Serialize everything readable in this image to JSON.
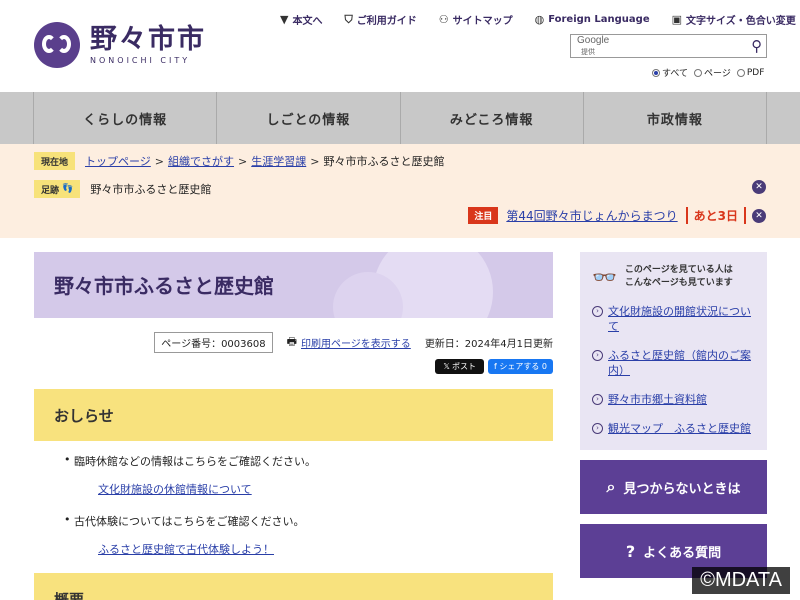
{
  "site": {
    "name": "野々市市",
    "name_en": "NONOICHI CITY"
  },
  "util_nav": [
    {
      "icon": "down-arrow-icon",
      "glyph": "▼",
      "label": "本文へ"
    },
    {
      "icon": "guide-icon",
      "glyph": "⛉",
      "label": "ご利用ガイド"
    },
    {
      "icon": "sitemap-icon",
      "glyph": "⚇",
      "label": "サイトマップ"
    },
    {
      "icon": "globe-icon",
      "glyph": "◍",
      "label": "Foreign Language"
    },
    {
      "icon": "font-size-icon",
      "glyph": "▣",
      "label": "文字サイズ・色合い変更"
    }
  ],
  "search": {
    "brand": "Google",
    "brand_sub": "提供",
    "value": "",
    "options": [
      "すべて",
      "ページ",
      "PDF"
    ],
    "selected": "すべて"
  },
  "gnav": [
    "くらしの情報",
    "しごとの情報",
    "みどころ情報",
    "市政情報"
  ],
  "breadcrumb": {
    "label": "現在地",
    "items": [
      "トップページ",
      "組織でさがす",
      "生涯学習課"
    ],
    "current": "野々市市ふるさと歴史館"
  },
  "footprint": {
    "label": "足跡",
    "text": "野々市市ふるさと歴史館"
  },
  "notice": {
    "label": "注目",
    "text": "第44回野々市じょんからまつり",
    "days": "あと3日"
  },
  "page": {
    "title": "野々市市ふるさと歴史館",
    "page_no": "ページ番号：0003608",
    "print": "印刷用ページを表示する",
    "updated": "更新日：2024年4月1日更新",
    "x_post": "𝕏 ポスト",
    "fb_share": "f シェアする 0"
  },
  "news": {
    "heading": "おしらせ",
    "items": [
      {
        "text": "臨時休館などの情報はこちらをご確認ください。",
        "link": "文化財施設の休館情報について"
      },
      {
        "text": "古代体験についてはこちらをご確認ください。",
        "link": "ふるさと歴史館で古代体験しよう！"
      }
    ]
  },
  "overview": {
    "heading": "概要"
  },
  "sidebar": {
    "related_heading_1": "このページを見ている人は",
    "related_heading_2": "こんなページも見ています",
    "related": [
      "文化財施設の開館状況について",
      "ふるさと歴史館（館内のご案内）",
      "野々市市郷土資料館",
      "観光マップ　ふるさと歴史館"
    ],
    "not_found": "見つからないときは",
    "faq": "よくある質問"
  },
  "watermark": "©MDATA",
  "colors": {
    "brand_purple": "#5c3f95",
    "title_band": "#d4c9e9",
    "section_yellow": "#f8e27e",
    "crumb_bg": "#fdeee0",
    "notice_red": "#d9361b",
    "gnav_gray": "#c8c8c8"
  }
}
